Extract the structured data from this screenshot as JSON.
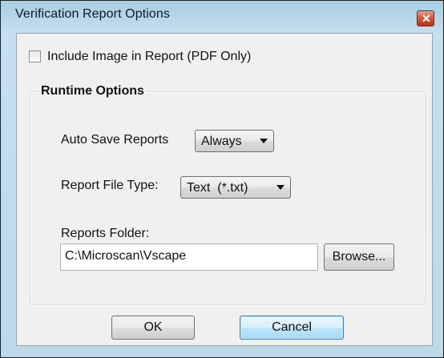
{
  "window": {
    "title": "Verification Report Options",
    "close_icon": "close-icon"
  },
  "include_image": {
    "label": "Include Image in Report (PDF Only)",
    "checked": false
  },
  "runtime_options": {
    "title": "Runtime Options",
    "auto_save_label": "Auto Save Reports",
    "auto_save_value": "Always",
    "file_type_label": "Report File Type:",
    "file_type_value": "Text  (*.txt)",
    "folder_label": "Reports Folder:",
    "folder_value": "C:\\Microscan\\Vscape",
    "browse_label": "Browse..."
  },
  "buttons": {
    "ok_label": "OK",
    "cancel_label": "Cancel"
  },
  "colors": {
    "title_bar": "#bcd9e9",
    "dialog_bg": "#f0f0f0",
    "close_button": "#d0553c",
    "focused_button_border": "#3c7fb1"
  }
}
